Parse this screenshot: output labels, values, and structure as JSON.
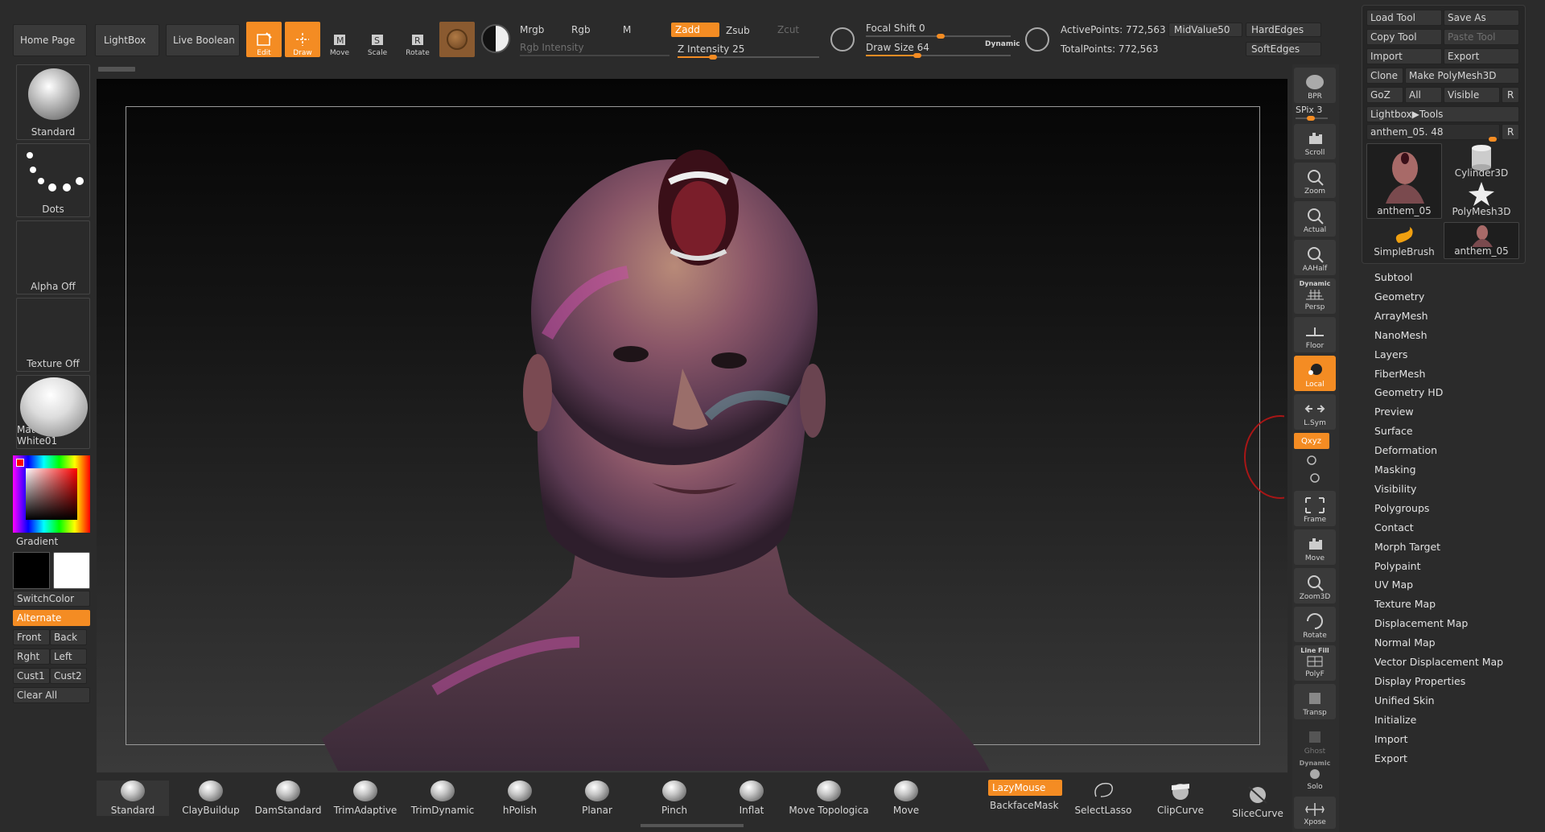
{
  "top_left": {
    "home_page": "Home Page",
    "lightbox": "LightBox",
    "live_boolean": "Live Boolean"
  },
  "transform": {
    "edit": "Edit",
    "draw": "Draw",
    "move": "Move",
    "scale": "Scale",
    "rotate": "Rotate"
  },
  "color_modes": {
    "mrgb": "Mrgb",
    "rgb": "Rgb",
    "m": "M",
    "zadd": "Zadd",
    "zsub": "Zsub",
    "zcut": "Zcut",
    "rgb_intensity": "Rgb Intensity",
    "z_intensity": "Z Intensity 25",
    "z_intensity_level": 25
  },
  "draw_settings": {
    "focal_shift": "Focal Shift 0",
    "draw_size": "Draw Size 64",
    "dynamic": "Dynamic",
    "draw_size_level": 64
  },
  "stats": {
    "active_points": "ActivePoints: 772,563",
    "total_points": "TotalPoints: 772,563",
    "midvalue": "MidValue50",
    "hardedges": "HardEdges",
    "softedges": "SoftEdges"
  },
  "left_panel": {
    "standard": "Standard",
    "dots": "Dots",
    "alpha": "Alpha Off",
    "texture": "Texture Off",
    "matcap": "MatCap White01",
    "gradient": "Gradient",
    "switchcolor": "SwitchColor",
    "alternate": "Alternate",
    "front": "Front",
    "back": "Back",
    "rght": "Rght",
    "left": "Left",
    "cust1": "Cust1",
    "cust2": "Cust2",
    "clear_all": "Clear All"
  },
  "right_tools": {
    "bpr": "BPR",
    "spix": "SPix 3",
    "scroll": "Scroll",
    "zoom": "Zoom",
    "actual": "Actual",
    "aahalf": "AAHalf",
    "dynamic": "Dynamic",
    "persp": "Persp",
    "floor": "Floor",
    "local": "Local",
    "lsym": "L.Sym",
    "xyz": "Qxyz",
    "frame": "Frame",
    "move": "Move",
    "zoom3d": "Zoom3D",
    "rotate": "Rotate",
    "line_fill": "Line Fill",
    "polyf": "PolyF",
    "transp": "Transp",
    "ghost": "Ghost",
    "dynamic2": "Dynamic",
    "solo": "Solo",
    "xpose": "Xpose"
  },
  "tool_panel": {
    "load_tool": "Load Tool",
    "save_as": "Save As",
    "copy_tool": "Copy Tool",
    "paste_tool": "Paste Tool",
    "import": "Import",
    "export": "Export",
    "clone": "Clone",
    "make_polymesh": "Make PolyMesh3D",
    "goz": "GoZ",
    "all": "All",
    "visible": "Visible",
    "r": "R",
    "lightbox_tools": "Lightbox▶Tools",
    "current_tool": "anthem_05. 48",
    "current_r": "R",
    "thumbs": [
      "anthem_05",
      "Cylinder3D",
      "PolyMesh3D",
      "SimpleBrush",
      "anthem_05"
    ]
  },
  "menu_items": [
    "Subtool",
    "Geometry",
    "ArrayMesh",
    "NanoMesh",
    "Layers",
    "FiberMesh",
    "Geometry HD",
    "Preview",
    "Surface",
    "Deformation",
    "Masking",
    "Visibility",
    "Polygroups",
    "Contact",
    "Morph Target",
    "Polypaint",
    "UV Map",
    "Texture Map",
    "Displacement Map",
    "Normal Map",
    "Vector Displacement Map",
    "Display Properties",
    "Unified Skin",
    "Initialize",
    "Import",
    "Export"
  ],
  "brushes": [
    "Standard",
    "ClayBuildup",
    "DamStandard",
    "TrimAdaptive",
    "TrimDynamic",
    "hPolish",
    "Planar",
    "Pinch",
    "Inflat",
    "Move Topologica",
    "Move"
  ],
  "bottom_right": {
    "lazymouse": "LazyMouse",
    "backfacemask": "BackfaceMask",
    "selectlasso": "SelectLasso",
    "clipcurve": "ClipCurve",
    "slicecurve": "SliceCurve"
  },
  "colors": {
    "accent": "#f48c23",
    "panel": "#2b2b2b",
    "button": "#373737"
  }
}
